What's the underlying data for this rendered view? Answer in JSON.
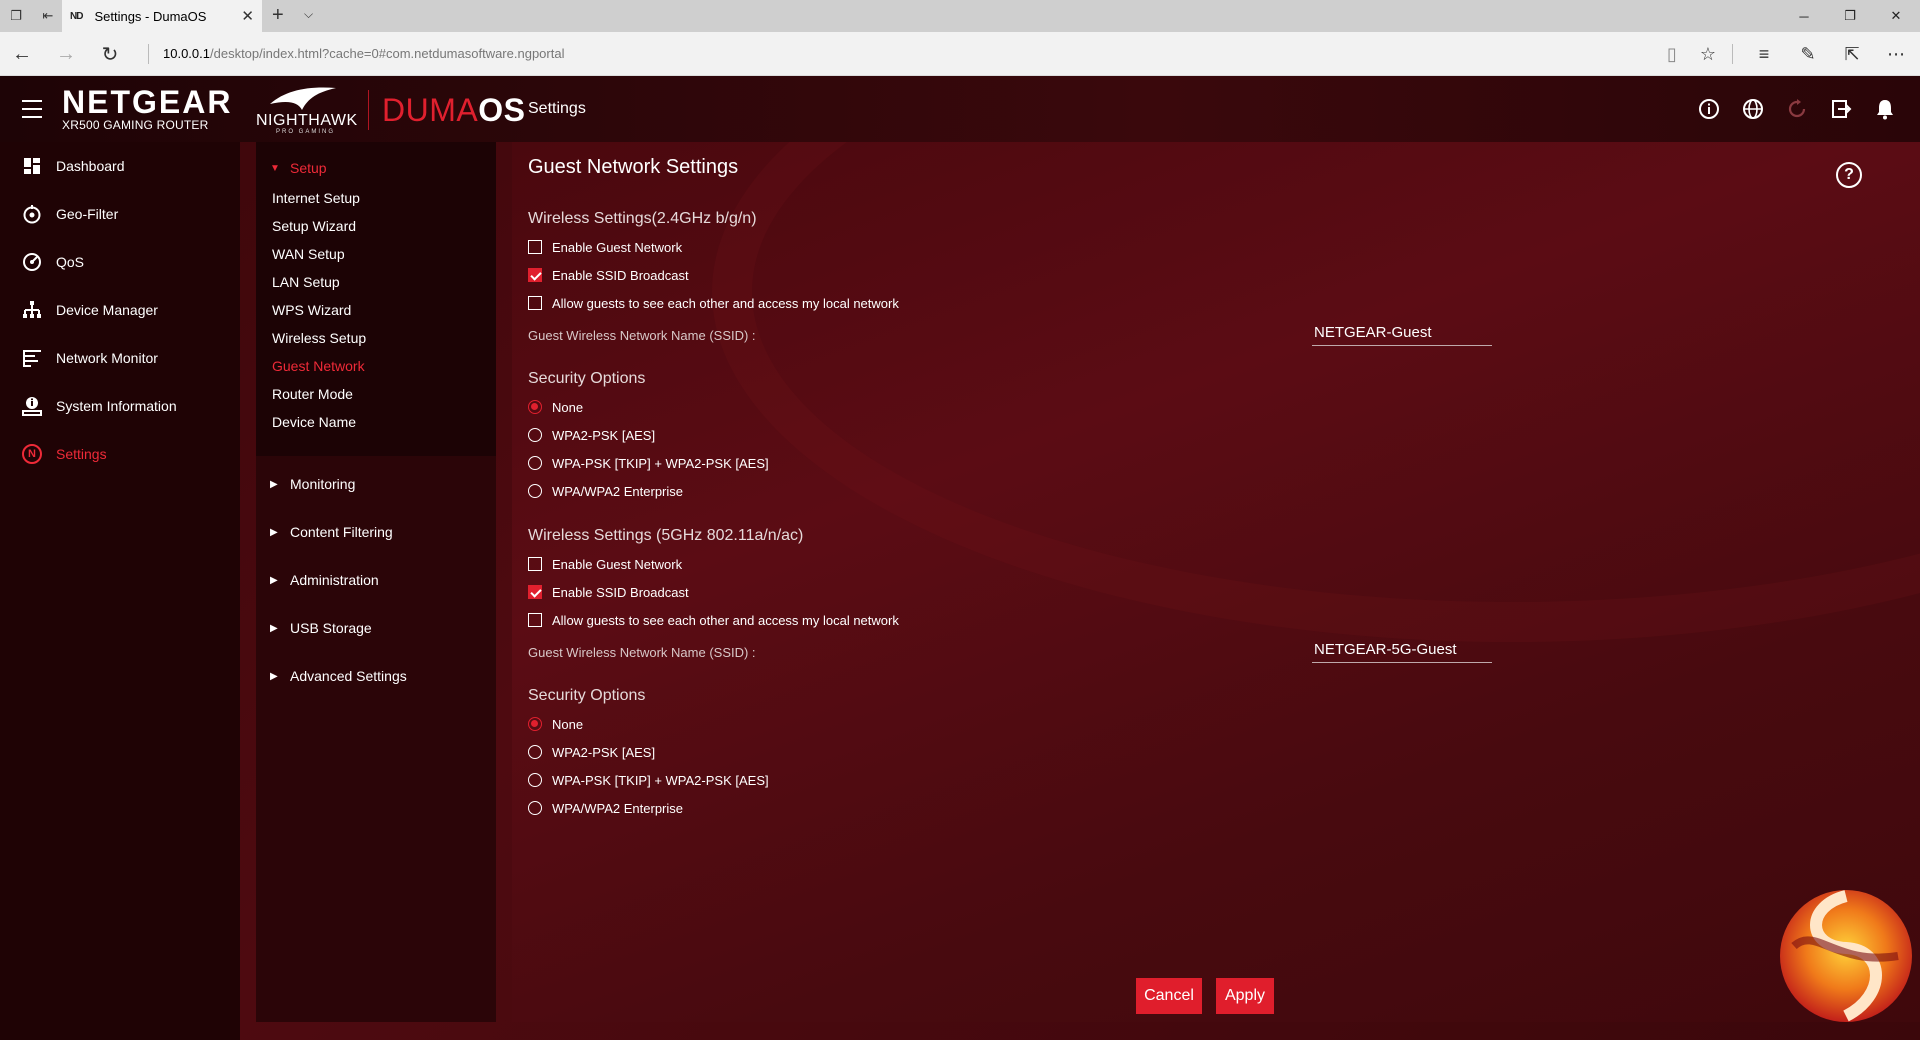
{
  "browser": {
    "tab_title": "Settings - DumaOS",
    "tab_favicon": "ND",
    "url_host": "10.0.0.1",
    "url_path": "/desktop/index.html?cache=0#com.netdumasoftware.ngportal"
  },
  "header": {
    "brand": "NETGEAR",
    "brand_sub": "XR500 GAMING ROUTER",
    "nighthawk": "NIGHTHAWK",
    "nighthawk_sub": "PRO GAMING",
    "duma_part1": "DUMA",
    "duma_part2": "OS",
    "page_title": "Settings"
  },
  "main_nav": [
    {
      "label": "Dashboard",
      "icon": "dashboard-icon"
    },
    {
      "label": "Geo-Filter",
      "icon": "geo-filter-icon"
    },
    {
      "label": "QoS",
      "icon": "qos-icon"
    },
    {
      "label": "Device Manager",
      "icon": "device-manager-icon"
    },
    {
      "label": "Network Monitor",
      "icon": "network-monitor-icon"
    },
    {
      "label": "System Information",
      "icon": "system-information-icon"
    },
    {
      "label": "Settings",
      "icon": "settings-n-icon",
      "active": true
    }
  ],
  "sub_nav": {
    "setup_label": "Setup",
    "setup_items": [
      "Internet Setup",
      "Setup Wizard",
      "WAN Setup",
      "LAN Setup",
      "WPS Wizard",
      "Wireless Setup",
      "Guest Network",
      "Router Mode",
      "Device Name"
    ],
    "active_item": "Guest Network",
    "sections": [
      "Monitoring",
      "Content Filtering",
      "Administration",
      "USB Storage",
      "Advanced Settings"
    ]
  },
  "content": {
    "title": "Guest Network Settings",
    "band24": {
      "heading": "Wireless Settings(2.4GHz b/g/n)",
      "enable_guest": "Enable Guest Network",
      "enable_guest_checked": false,
      "enable_ssid": "Enable SSID Broadcast",
      "enable_ssid_checked": true,
      "allow_guests": "Allow guests to see each other and access my local network",
      "allow_guests_checked": false,
      "ssid_label": "Guest Wireless Network Name (SSID) :",
      "ssid_value": "NETGEAR-Guest",
      "security_heading": "Security Options",
      "security_options": [
        "None",
        "WPA2-PSK [AES]",
        "WPA-PSK [TKIP] + WPA2-PSK [AES]",
        "WPA/WPA2 Enterprise"
      ],
      "security_selected": "None"
    },
    "band5": {
      "heading": "Wireless Settings (5GHz 802.11a/n/ac)",
      "enable_guest": "Enable Guest Network",
      "enable_guest_checked": false,
      "enable_ssid": "Enable SSID Broadcast",
      "enable_ssid_checked": true,
      "allow_guests": "Allow guests to see each other and access my local network",
      "allow_guests_checked": false,
      "ssid_label": "Guest Wireless Network Name (SSID) :",
      "ssid_value": "NETGEAR-5G-Guest",
      "security_heading": "Security Options",
      "security_options": [
        "None",
        "WPA2-PSK [AES]",
        "WPA-PSK [TKIP] + WPA2-PSK [AES]",
        "WPA/WPA2 Enterprise"
      ],
      "security_selected": "None"
    },
    "cancel_label": "Cancel",
    "apply_label": "Apply"
  },
  "colors": {
    "accent": "#e0202e",
    "nav_bg": "#1f0305",
    "panel_bg": "#4a080e"
  }
}
